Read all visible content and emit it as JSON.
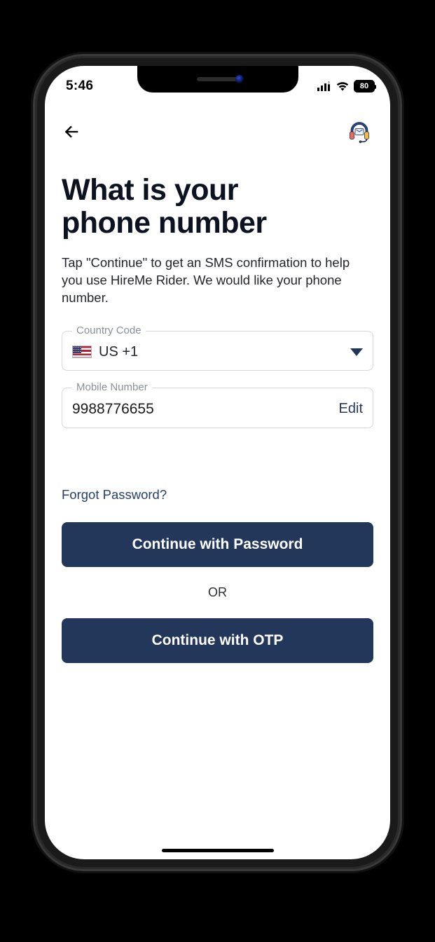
{
  "statusbar": {
    "time": "5:46",
    "battery": "80"
  },
  "header": {
    "back_icon": "arrow-left",
    "support_icon": "headset"
  },
  "page": {
    "title_line1": "What is your",
    "title_line2": "phone number",
    "subtitle": "Tap \"Continue\" to get an SMS confirmation to help you use HireMe Rider. We would like your phone number."
  },
  "country_code": {
    "label": "Country Code",
    "value": "US +1",
    "flag": "us"
  },
  "mobile": {
    "label": "Mobile Number",
    "value": "9988776655",
    "edit_label": "Edit"
  },
  "links": {
    "forgot": "Forgot Password?"
  },
  "buttons": {
    "password": "Continue with Password",
    "divider": "OR",
    "otp": "Continue with OTP"
  }
}
